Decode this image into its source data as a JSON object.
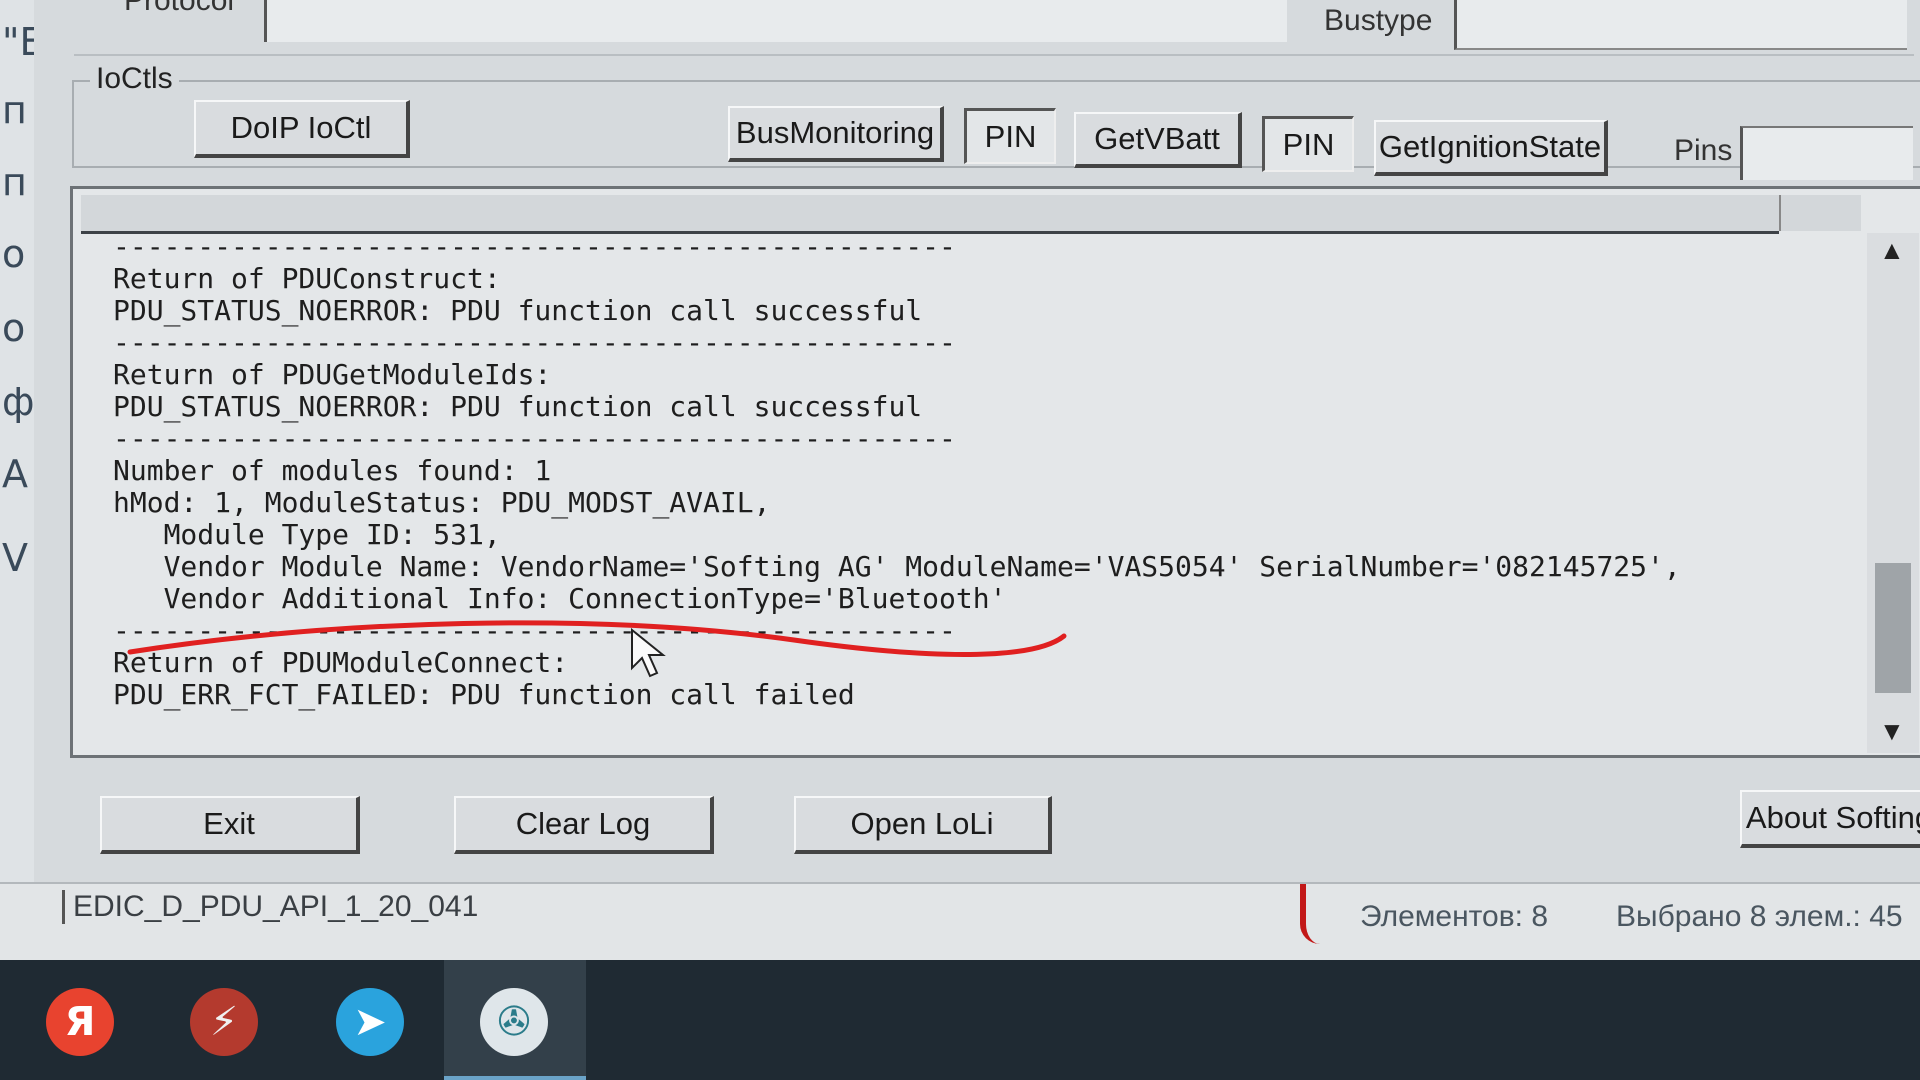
{
  "window": {
    "protocol_label": "Protocol",
    "bustype_label": "Bustype"
  },
  "ioctls": {
    "legend": "IoCtls",
    "doip_button": "DoIP IoCtl",
    "busmonitoring_button": "BusMonitoring",
    "pin1_button": "PIN",
    "getvbatt_button": "GetVBatt",
    "pin2_button": "PIN",
    "getignition_button": "GetIgnitionState",
    "pins_label": "Pins"
  },
  "log": {
    "lines": [
      "--------------------------------------------------",
      "Return of PDUConstruct:",
      "PDU_STATUS_NOERROR: PDU function call successful",
      "--------------------------------------------------",
      "Return of PDUGetModuleIds:",
      "PDU_STATUS_NOERROR: PDU function call successful",
      "--------------------------------------------------",
      "Number of modules found: 1",
      "hMod: 1, ModuleStatus: PDU_MODST_AVAIL,",
      "   Module Type ID: 531,",
      "   Vendor Module Name: VendorName='Softing AG' ModuleName='VAS5054' SerialNumber='082145725',",
      "   Vendor Additional Info: ConnectionType='Bluetooth'",
      "--------------------------------------------------",
      "Return of PDUModuleConnect:",
      "PDU_ERR_FCT_FAILED: PDU function call failed"
    ],
    "annotation_color": "#e02020"
  },
  "buttons": {
    "exit": "Exit",
    "clear_log": "Clear Log",
    "open_loli": "Open LoLi",
    "about": "About Softing"
  },
  "status_bar": {
    "version": "EDIC_D_PDU_API_1_20_041",
    "elements": "Элементов: 8",
    "selected": "Выбрано 8 элем.: 45"
  },
  "background_window": {
    "glyphs": [
      "\"E",
      "п",
      "п",
      "о",
      "о",
      "ф",
      "А",
      "V"
    ]
  },
  "taskbar": {
    "icons": [
      {
        "name": "yandex-browser-icon",
        "glyph": "Я",
        "color": "#e8432f"
      },
      {
        "name": "flash-icon",
        "glyph": "⚡",
        "color": "#f0f0f0"
      },
      {
        "name": "telegram-icon",
        "glyph": "➤",
        "color": "#2aa3dd"
      },
      {
        "name": "vw-app-icon",
        "glyph": "✇",
        "color": "#2b7c8a"
      }
    ]
  }
}
